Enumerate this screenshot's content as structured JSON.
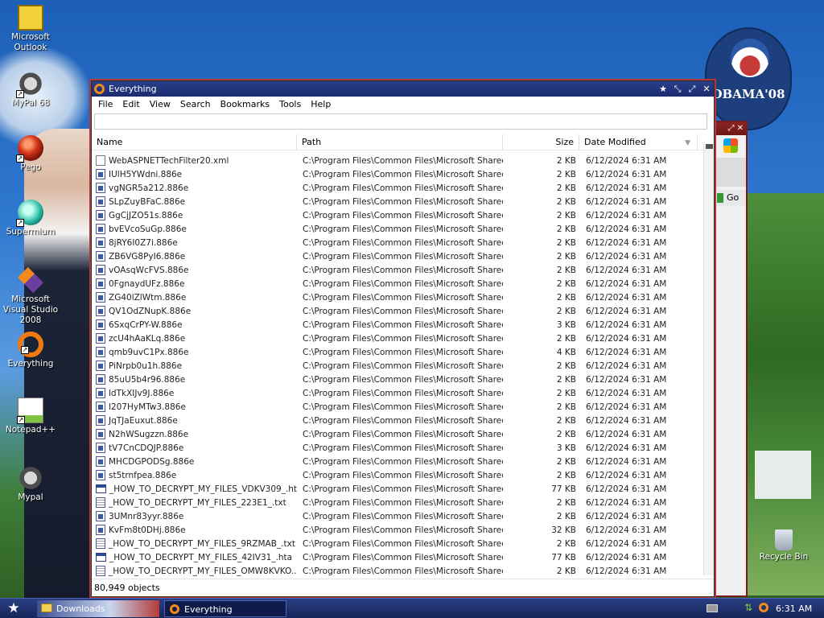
{
  "desktop": {
    "icons": [
      {
        "label": "Microsoft Outlook",
        "icon": "outlook-icon"
      },
      {
        "label": "MyPal 68",
        "icon": "raccoon-icon"
      },
      {
        "label": "Pego",
        "icon": "pego-icon"
      },
      {
        "label": "Supermium",
        "icon": "supermium-icon"
      },
      {
        "label": "Microsoft Visual Studio 2008",
        "icon": "visual-studio-icon"
      },
      {
        "label": "Everything",
        "icon": "everything-icon"
      },
      {
        "label": "Notepad++",
        "icon": "notepad-plus-icon"
      },
      {
        "label": "Mypal",
        "icon": "raccoon-icon"
      }
    ],
    "recycle_bin": "Recycle Bin",
    "wallpaper_logo_text": "OBAMA'08"
  },
  "window": {
    "title": "Everything",
    "menu": [
      "File",
      "Edit",
      "View",
      "Search",
      "Bookmarks",
      "Tools",
      "Help"
    ],
    "search_value": "",
    "columns": {
      "name": "Name",
      "path": "Path",
      "size": "Size",
      "date": "Date Modified"
    },
    "rows": [
      {
        "name": "WebASPNETTechFilter20.xml",
        "path": "C:\\Program Files\\Common Files\\Microsoft Shared...",
        "size": "2 KB",
        "date": "6/12/2024 6:31 AM",
        "type": "xml"
      },
      {
        "name": "IUlH5YWdni.886e",
        "path": "C:\\Program Files\\Common Files\\Microsoft Shared...",
        "size": "2 KB",
        "date": "6/12/2024 6:31 AM",
        "type": "cfg"
      },
      {
        "name": "vgNGR5a212.886e",
        "path": "C:\\Program Files\\Common Files\\Microsoft Shared...",
        "size": "2 KB",
        "date": "6/12/2024 6:31 AM",
        "type": "cfg"
      },
      {
        "name": "SLpZuyBFaC.886e",
        "path": "C:\\Program Files\\Common Files\\Microsoft Shared...",
        "size": "2 KB",
        "date": "6/12/2024 6:31 AM",
        "type": "cfg"
      },
      {
        "name": "GgCjJZO51s.886e",
        "path": "C:\\Program Files\\Common Files\\Microsoft Shared...",
        "size": "2 KB",
        "date": "6/12/2024 6:31 AM",
        "type": "cfg"
      },
      {
        "name": "bvEVcoSuGp.886e",
        "path": "C:\\Program Files\\Common Files\\Microsoft Shared...",
        "size": "2 KB",
        "date": "6/12/2024 6:31 AM",
        "type": "cfg"
      },
      {
        "name": "8jRY6I0Z7i.886e",
        "path": "C:\\Program Files\\Common Files\\Microsoft Shared...",
        "size": "2 KB",
        "date": "6/12/2024 6:31 AM",
        "type": "cfg"
      },
      {
        "name": "ZB6VG8PyI6.886e",
        "path": "C:\\Program Files\\Common Files\\Microsoft Shared...",
        "size": "2 KB",
        "date": "6/12/2024 6:31 AM",
        "type": "cfg"
      },
      {
        "name": "vOAsqWcFVS.886e",
        "path": "C:\\Program Files\\Common Files\\Microsoft Shared...",
        "size": "2 KB",
        "date": "6/12/2024 6:31 AM",
        "type": "cfg"
      },
      {
        "name": "0FgnaydUFz.886e",
        "path": "C:\\Program Files\\Common Files\\Microsoft Shared...",
        "size": "2 KB",
        "date": "6/12/2024 6:31 AM",
        "type": "cfg"
      },
      {
        "name": "ZG40lZlWtm.886e",
        "path": "C:\\Program Files\\Common Files\\Microsoft Shared...",
        "size": "2 KB",
        "date": "6/12/2024 6:31 AM",
        "type": "cfg"
      },
      {
        "name": "QV1OdZNupK.886e",
        "path": "C:\\Program Files\\Common Files\\Microsoft Shared...",
        "size": "2 KB",
        "date": "6/12/2024 6:31 AM",
        "type": "cfg"
      },
      {
        "name": "6SxqCrPY-W.886e",
        "path": "C:\\Program Files\\Common Files\\Microsoft Shared...",
        "size": "3 KB",
        "date": "6/12/2024 6:31 AM",
        "type": "cfg"
      },
      {
        "name": "zcU4hAaKLq.886e",
        "path": "C:\\Program Files\\Common Files\\Microsoft Shared...",
        "size": "2 KB",
        "date": "6/12/2024 6:31 AM",
        "type": "cfg"
      },
      {
        "name": "qmb9uvC1Px.886e",
        "path": "C:\\Program Files\\Common Files\\Microsoft Shared...",
        "size": "4 KB",
        "date": "6/12/2024 6:31 AM",
        "type": "cfg"
      },
      {
        "name": "PiNrpb0u1h.886e",
        "path": "C:\\Program Files\\Common Files\\Microsoft Shared...",
        "size": "2 KB",
        "date": "6/12/2024 6:31 AM",
        "type": "cfg"
      },
      {
        "name": "85uU5b4r96.886e",
        "path": "C:\\Program Files\\Common Files\\Microsoft Shared...",
        "size": "2 KB",
        "date": "6/12/2024 6:31 AM",
        "type": "cfg"
      },
      {
        "name": "ldTkXIJv9J.886e",
        "path": "C:\\Program Files\\Common Files\\Microsoft Shared...",
        "size": "2 KB",
        "date": "6/12/2024 6:31 AM",
        "type": "cfg"
      },
      {
        "name": "l207HyMTw3.886e",
        "path": "C:\\Program Files\\Common Files\\Microsoft Shared...",
        "size": "2 KB",
        "date": "6/12/2024 6:31 AM",
        "type": "cfg"
      },
      {
        "name": "JqTJaEuxut.886e",
        "path": "C:\\Program Files\\Common Files\\Microsoft Shared...",
        "size": "2 KB",
        "date": "6/12/2024 6:31 AM",
        "type": "cfg"
      },
      {
        "name": "N2hWSugzzn.886e",
        "path": "C:\\Program Files\\Common Files\\Microsoft Shared...",
        "size": "2 KB",
        "date": "6/12/2024 6:31 AM",
        "type": "cfg"
      },
      {
        "name": "tV7CnCDQJP.886e",
        "path": "C:\\Program Files\\Common Files\\Microsoft Shared...",
        "size": "3 KB",
        "date": "6/12/2024 6:31 AM",
        "type": "cfg"
      },
      {
        "name": "MHCDGPODSg.886e",
        "path": "C:\\Program Files\\Common Files\\Microsoft Shared...",
        "size": "2 KB",
        "date": "6/12/2024 6:31 AM",
        "type": "cfg"
      },
      {
        "name": "st5trnfpea.886e",
        "path": "C:\\Program Files\\Common Files\\Microsoft Shared...",
        "size": "2 KB",
        "date": "6/12/2024 6:31 AM",
        "type": "cfg"
      },
      {
        "name": "_HOW_TO_DECRYPT_MY_FILES_VDKV309_.hta",
        "path": "C:\\Program Files\\Common Files\\Microsoft Shared...",
        "size": "77 KB",
        "date": "6/12/2024 6:31 AM",
        "type": "hta"
      },
      {
        "name": "_HOW_TO_DECRYPT_MY_FILES_223E1_.txt",
        "path": "C:\\Program Files\\Common Files\\Microsoft Shared...",
        "size": "2 KB",
        "date": "6/12/2024 6:31 AM",
        "type": "txt"
      },
      {
        "name": "3UMnr83yyr.886e",
        "path": "C:\\Program Files\\Common Files\\Microsoft Shared...",
        "size": "2 KB",
        "date": "6/12/2024 6:31 AM",
        "type": "cfg"
      },
      {
        "name": "KvFm8t0DHj.886e",
        "path": "C:\\Program Files\\Common Files\\Microsoft Shared...",
        "size": "32 KB",
        "date": "6/12/2024 6:31 AM",
        "type": "cfg"
      },
      {
        "name": "_HOW_TO_DECRYPT_MY_FILES_9RZMAB_.txt",
        "path": "C:\\Program Files\\Common Files\\Microsoft Shared...",
        "size": "2 KB",
        "date": "6/12/2024 6:31 AM",
        "type": "txt"
      },
      {
        "name": "_HOW_TO_DECRYPT_MY_FILES_42IV31_.hta",
        "path": "C:\\Program Files\\Common Files\\Microsoft Shared...",
        "size": "77 KB",
        "date": "6/12/2024 6:31 AM",
        "type": "hta"
      },
      {
        "name": "_HOW_TO_DECRYPT_MY_FILES_OMW8KVKO...",
        "path": "C:\\Program Files\\Common Files\\Microsoft Shared...",
        "size": "2 KB",
        "date": "6/12/2024 6:31 AM",
        "type": "txt"
      }
    ],
    "status": "80,949 objects"
  },
  "background_window": {
    "go_label": "Go"
  },
  "taskbar": {
    "tasks": [
      {
        "label": "Downloads"
      },
      {
        "label": "Everything"
      }
    ],
    "clock": "6:31 AM"
  }
}
